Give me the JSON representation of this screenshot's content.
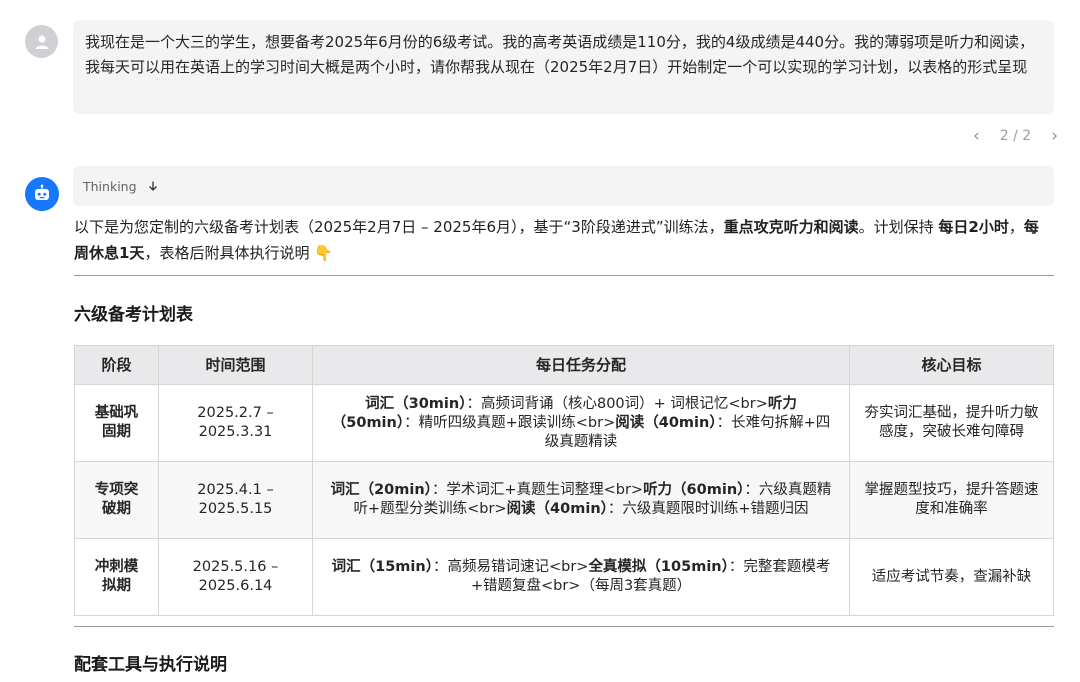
{
  "user": {
    "message": "我现在是一个大三的学生，想要备考2025年6月份的6级考试。我的高考英语成绩是110分，我的4级成绩是440分。我的薄弱项是听力和阅读，我每天可以用在英语上的学习时间大概是两个小时，请你帮我从现在（2025年2月7日）开始制定一个可以实现的学习计划，以表格的形式呈现"
  },
  "pager": {
    "text": "2 / 2"
  },
  "thinking": {
    "label": "Thinking"
  },
  "intro": {
    "p1": "以下是为您定制的六级备考计划表（2025年2月7日 – 2025年6月），基于“3阶段递进式”训练法，",
    "b1": "重点攻克听力和阅读",
    "p2": "。计划保持 ",
    "b2": "每日2小时",
    "p3": "，",
    "b3": "每周休息1天",
    "p4": "，表格后附具体执行说明 ",
    "emoji": "👇"
  },
  "section1_title": "六级备考计划表",
  "table": {
    "headers": [
      "阶段",
      "时间范围",
      "每日任务分配",
      "核心目标"
    ],
    "rows": [
      {
        "stage": "基础巩固期",
        "time": "2025.2.7 – 2025.3.31",
        "tasks": [
          {
            "b": "词汇（30min）"
          },
          {
            "t": "：高频词背诵（核心800词）+ 词根记忆<br>"
          },
          {
            "b": "听力（50min）"
          },
          {
            "t": "：精听四级真题+跟读训练<br>"
          },
          {
            "b": "阅读（40min）"
          },
          {
            "t": "：长难句拆解+四级真题精读"
          }
        ],
        "goal": "夯实词汇基础，提升听力敏感度，突破长难句障碍"
      },
      {
        "stage": "专项突破期",
        "time": "2025.4.1 – 2025.5.15",
        "tasks": [
          {
            "b": "词汇（20min）"
          },
          {
            "t": "：学术词汇+真题生词整理<br>"
          },
          {
            "b": "听力（60min）"
          },
          {
            "t": "：六级真题精听+题型分类训练<br>"
          },
          {
            "b": "阅读（40min）"
          },
          {
            "t": "：六级真题限时训练+错题归因"
          }
        ],
        "goal": "掌握题型技巧，提升答题速度和准确率"
      },
      {
        "stage": "冲刺模拟期",
        "time": "2025.5.16 – 2025.6.14",
        "tasks": [
          {
            "b": "词汇（15min）"
          },
          {
            "t": "：高频易错词速记<br>"
          },
          {
            "b": "全真模拟（105min）"
          },
          {
            "t": "：完整套题模考+错题复盘<br>（每周3套真题）"
          }
        ],
        "goal": "适应考试节奏，查漏补缺"
      }
    ]
  },
  "section2_title": "配套工具与执行说明"
}
